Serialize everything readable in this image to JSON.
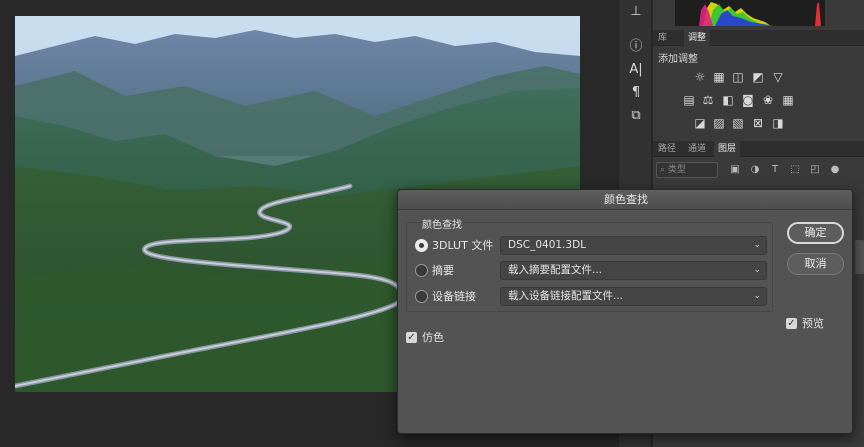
{
  "dialog": {
    "title": "颜色查找",
    "group_title": "颜色查找",
    "rows": [
      {
        "label": "3DLUT 文件",
        "value": "DSC_0401.3DL",
        "selected": true
      },
      {
        "label": "摘要",
        "value": "载入摘要配置文件...",
        "selected": false
      },
      {
        "label": "设备链接",
        "value": "载入设备链接配置文件...",
        "selected": false
      }
    ],
    "ok_label": "确定",
    "cancel_label": "取消",
    "preview_label": "预览",
    "preview_checked": true,
    "dither_label": "仿色",
    "dither_checked": true
  },
  "panels": {
    "tabs_top": [
      "库",
      "调整"
    ],
    "active_top": "调整",
    "adjust_label": "添加调整",
    "tabs_layers": [
      "路径",
      "通道",
      "图层"
    ],
    "active_layers": "图层",
    "layers_filter_placeholder": "类型"
  },
  "tools": {
    "icons": [
      "stamp-icon",
      "info-icon",
      "character-icon",
      "paragraph-icon",
      "glyph-icon"
    ]
  },
  "colors": {
    "dialog_bg": "#535353",
    "app_bg": "#282828",
    "panel_bg": "#3a3a3a"
  }
}
